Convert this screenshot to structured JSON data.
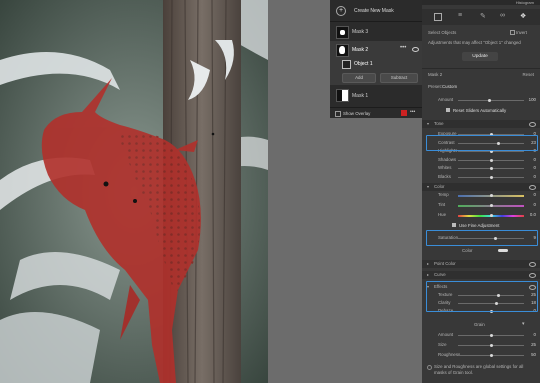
{
  "mask_panel": {
    "create_label": "Create New Mask",
    "items": [
      {
        "label": "Mask 3"
      },
      {
        "label": "Mask 2"
      },
      {
        "label": "Object 1"
      },
      {
        "label": "Mask 1"
      }
    ],
    "add_label": "Add",
    "subtract_label": "Subtract",
    "overlay_label": "Show Overlay",
    "overlay_color": "#cc2222"
  },
  "right_panel": {
    "header": "Histogram",
    "select_objects": "Select Objects",
    "invert": "Invert",
    "notice": "Adjustments that may affect \"Object 1\" changed",
    "update": "Update",
    "mask_name": "Mask 2",
    "reset": "Reset",
    "preset_label": "Preset:",
    "preset_value": "Custom",
    "amount_label": "Amount",
    "amount_value": "100",
    "reset_sliders": "Reset Sliders Automatically",
    "tone": {
      "title": "Tone",
      "sliders": [
        {
          "label": "Exposure",
          "value": "0",
          "pos": 0.5
        },
        {
          "label": "Contrast",
          "value": "23",
          "pos": 0.62
        },
        {
          "label": "Highlights",
          "value": "0",
          "pos": 0.5
        },
        {
          "label": "Shadows",
          "value": "0",
          "pos": 0.5
        },
        {
          "label": "Whites",
          "value": "0",
          "pos": 0.5
        },
        {
          "label": "Blacks",
          "value": "0",
          "pos": 0.5
        }
      ]
    },
    "color": {
      "title": "Color",
      "sliders": [
        {
          "label": "Temp",
          "value": "0",
          "pos": 0.5
        },
        {
          "label": "Tint",
          "value": "0",
          "pos": 0.5
        },
        {
          "label": "Hue",
          "value": "0.0",
          "pos": 0.5
        }
      ],
      "fine": "Use Fine Adjustment",
      "saturation": {
        "label": "Saturation",
        "value": "9",
        "pos": 0.55
      },
      "color_label": "Color"
    },
    "point_color": "Point Color",
    "curve": "Curve",
    "effects": {
      "title": "Effects",
      "sliders": [
        {
          "label": "Texture",
          "value": "25",
          "pos": 0.62
        },
        {
          "label": "Clarity",
          "value": "18",
          "pos": 0.59
        },
        {
          "label": "Dehaze",
          "value": "0",
          "pos": 0.5
        }
      ]
    },
    "grain_label": "Grain",
    "grain_sliders": [
      {
        "label": "Amount",
        "value": "0"
      },
      {
        "label": "Size",
        "value": "25"
      },
      {
        "label": "Roughness",
        "value": "50"
      }
    ],
    "footer": "Size and Roughness are global settings for all masks of Grain tool."
  }
}
